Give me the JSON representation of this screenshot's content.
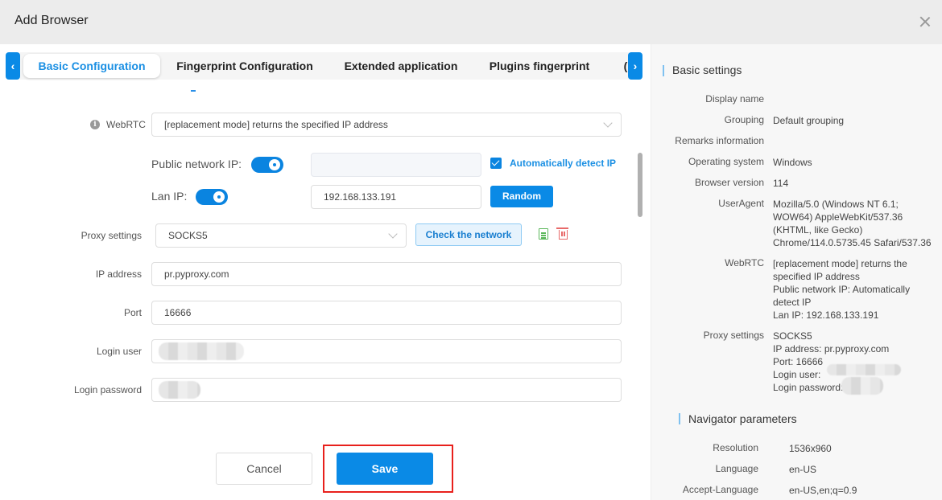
{
  "header": {
    "title": "Add Browser",
    "close_icon": "close-icon"
  },
  "tabs": [
    {
      "label": "Basic Configuration",
      "active": true
    },
    {
      "label": "Fingerprint Configuration",
      "active": false
    },
    {
      "label": "Extended application",
      "active": false
    },
    {
      "label": "Plugins fingerprint",
      "active": false
    },
    {
      "label": "(",
      "active": false
    }
  ],
  "tab_nav": {
    "prev": "‹",
    "next": "›"
  },
  "form": {
    "webrtc": {
      "label": "WebRTC",
      "value": "[replacement mode] returns the specified IP address",
      "info_icon": "i"
    },
    "public_ip": {
      "label": "Public network IP:",
      "enabled": true,
      "value": "",
      "auto_detect_label": "Automatically detect IP",
      "auto_detect_checked": true
    },
    "lan_ip": {
      "label": "Lan IP:",
      "enabled": true,
      "value": "192.168.133.191",
      "random_label": "Random"
    },
    "proxy": {
      "label": "Proxy settings",
      "value": "SOCKS5",
      "check_label": "Check the network"
    },
    "ip_address": {
      "label": "IP address",
      "value": "pr.pyproxy.com"
    },
    "port": {
      "label": "Port",
      "value": "16666"
    },
    "login_user": {
      "label": "Login user",
      "value": ""
    },
    "login_password": {
      "label": "Login password",
      "value": ""
    }
  },
  "footer": {
    "cancel": "Cancel",
    "save": "Save"
  },
  "summary": {
    "basic_title": "Basic settings",
    "basic": [
      {
        "label": "Display name",
        "lines": [
          ""
        ]
      },
      {
        "label": "Grouping",
        "lines": [
          "Default grouping"
        ]
      },
      {
        "label": "Remarks information",
        "lines": [
          ""
        ]
      },
      {
        "label": "Operating system",
        "lines": [
          "Windows"
        ]
      },
      {
        "label": "Browser version",
        "lines": [
          "114"
        ]
      },
      {
        "label": "UserAgent",
        "lines": [
          "Mozilla/5.0 (Windows NT 6.1;",
          "WOW64) AppleWebKit/537.36",
          "(KHTML, like Gecko)",
          "Chrome/114.0.5735.45 Safari/537.36"
        ]
      },
      {
        "label": "WebRTC",
        "lines": [
          "[replacement mode] returns the",
          "specified IP address",
          "Public network IP:  Automatically",
          "detect IP",
          "Lan IP:  192.168.133.191"
        ]
      },
      {
        "label": "Proxy settings",
        "lines": [
          "SOCKS5",
          "IP address:  pr.pyproxy.com",
          "Port:  16666",
          "Login user:",
          "Login password:"
        ]
      }
    ],
    "navigator_title": "Navigator parameters",
    "navigator": [
      {
        "label": "Resolution",
        "lines": [
          "1536x960"
        ]
      },
      {
        "label": "Language",
        "lines": [
          "en-US"
        ]
      },
      {
        "label": "Accept-Language",
        "lines": [
          "en-US,en;q=0.9"
        ]
      }
    ]
  }
}
